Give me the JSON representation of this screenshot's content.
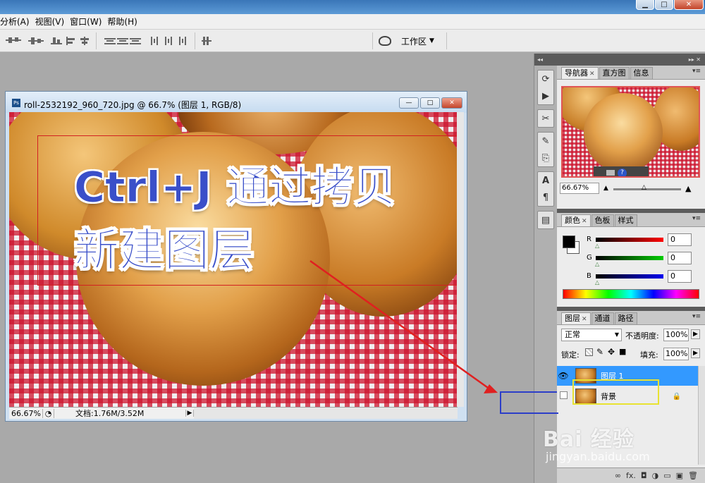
{
  "window": {
    "min_symbol": "▁",
    "max_symbol": "□",
    "close_symbol": "✕"
  },
  "menu": {
    "items": [
      "分析(A)",
      "视图(V)",
      "窗口(W)",
      "帮助(H)"
    ]
  },
  "toolbar": {
    "workspace_label": "工作区",
    "workspace_arrow": "▼"
  },
  "document": {
    "title": "roll-2532192_960_720.jpg @ 66.7% (图层 1, RGB/8)",
    "zoom": "66.67%",
    "doc_size": "文档:1.76M/3.52M",
    "overlay_line1": "Ctrl+J 通过拷贝",
    "overlay_line2": "新建图层",
    "min_symbol": "—",
    "max_symbol": "□",
    "close_symbol": "✕"
  },
  "navigator": {
    "tabs": [
      "导航器",
      "直方图",
      "信息"
    ],
    "zoom": "66.67%",
    "help_symbol": "?"
  },
  "color": {
    "tabs": [
      "颜色",
      "色板",
      "样式"
    ],
    "channels": [
      {
        "label": "R",
        "value": "0"
      },
      {
        "label": "G",
        "value": "0"
      },
      {
        "label": "B",
        "value": "0"
      }
    ]
  },
  "layers": {
    "tabs": [
      "图层",
      "通道",
      "路径"
    ],
    "blend_mode": "正常",
    "opacity_label": "不透明度:",
    "opacity_value": "100%",
    "lock_label": "锁定:",
    "fill_label": "填充:",
    "fill_value": "100%",
    "items": [
      {
        "name": "图层 1",
        "selected": true,
        "visible": true
      },
      {
        "name": "背景",
        "selected": false,
        "visible": false,
        "locked": true
      }
    ],
    "bottom_icons": [
      "∞",
      "fx.",
      "◘",
      "◑",
      "▭",
      "▣",
      "🗑"
    ]
  },
  "watermark": {
    "brand": "Bai 经验",
    "url": "jingyan.baidu.com"
  },
  "colors": {
    "accent_blue": "#3399ff",
    "annotation_red": "#e02020",
    "annotation_blue": "#2c3ec8",
    "highlight_yellow": "#e8e231"
  }
}
